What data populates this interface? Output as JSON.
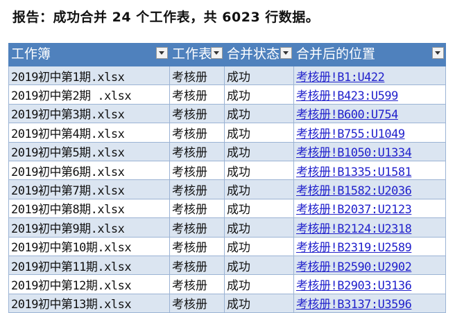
{
  "report": {
    "text": "报告：成功合并 24 个工作表，共 6023 行数据。"
  },
  "icons": {
    "filter_dropdown": "chevron-down-icon"
  },
  "colors": {
    "header_bg": "#4f81bd",
    "band_row": "#dbe5f1",
    "link": "#2222cc"
  },
  "table": {
    "headers": [
      "工作簿",
      "工作表",
      "合并状态",
      "合并后的位置"
    ],
    "rows": [
      {
        "workbook": "2019初中第1期.xlsx",
        "sheet": "考核册",
        "status": "成功",
        "location": "考核册!B1:U422"
      },
      {
        "workbook": "2019初中第2期 .xlsx",
        "sheet": "考核册",
        "status": "成功",
        "location": "考核册!B423:U599"
      },
      {
        "workbook": "2019初中第3期.xlsx",
        "sheet": "考核册",
        "status": "成功",
        "location": "考核册!B600:U754"
      },
      {
        "workbook": "2019初中第4期.xlsx",
        "sheet": "考核册",
        "status": "成功",
        "location": "考核册!B755:U1049"
      },
      {
        "workbook": "2019初中第5期.xlsx",
        "sheet": "考核册",
        "status": "成功",
        "location": "考核册!B1050:U1334"
      },
      {
        "workbook": "2019初中第6期.xlsx",
        "sheet": "考核册",
        "status": "成功",
        "location": "考核册!B1335:U1581"
      },
      {
        "workbook": "2019初中第7期.xlsx",
        "sheet": "考核册",
        "status": "成功",
        "location": "考核册!B1582:U2036"
      },
      {
        "workbook": "2019初中第8期.xlsx",
        "sheet": "考核册",
        "status": "成功",
        "location": "考核册!B2037:U2123"
      },
      {
        "workbook": "2019初中第9期.xlsx",
        "sheet": "考核册",
        "status": "成功",
        "location": "考核册!B2124:U2318"
      },
      {
        "workbook": "2019初中第10期.xlsx",
        "sheet": "考核册",
        "status": "成功",
        "location": "考核册!B2319:U2589"
      },
      {
        "workbook": "2019初中第11期.xlsx",
        "sheet": "考核册",
        "status": "成功",
        "location": "考核册!B2590:U2902"
      },
      {
        "workbook": "2019初中第12期.xlsx",
        "sheet": "考核册",
        "status": "成功",
        "location": "考核册!B2903:U3136"
      },
      {
        "workbook": "2019初中第13期.xlsx",
        "sheet": "考核册",
        "status": "成功",
        "location": "考核册!B3137:U3596"
      }
    ]
  }
}
